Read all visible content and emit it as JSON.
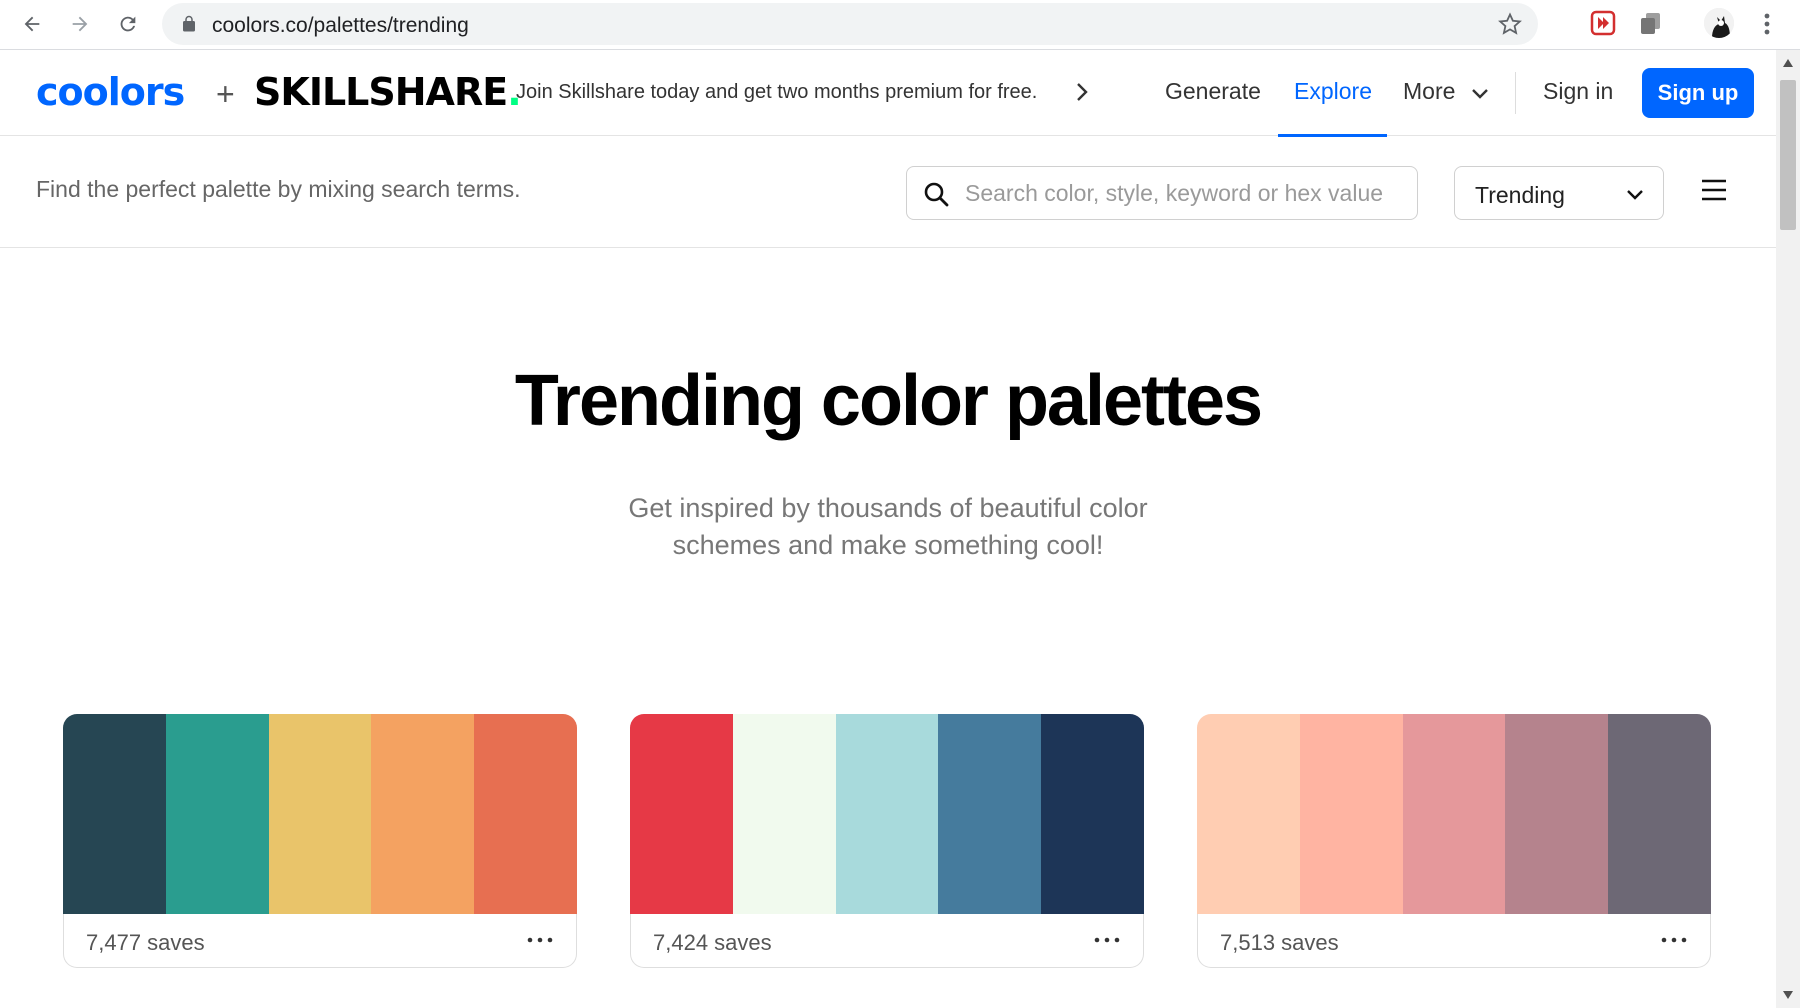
{
  "browser": {
    "url": "coolors.co/palettes/trending",
    "icons": [
      "back-icon",
      "forward-icon",
      "reload-icon",
      "lock-icon",
      "star-icon",
      "extension-icon",
      "profile-avatar",
      "menu-kebab-icon"
    ]
  },
  "header": {
    "logo_coolors": "coolors",
    "logo_plus": "+",
    "logo_skillshare": "SKILLSHARE",
    "logo_skillshare_dot": ".",
    "promo_text": "Join Skillshare today and get two months premium for free.",
    "nav": {
      "generate": "Generate",
      "explore": "Explore",
      "more": "More",
      "signin": "Sign in",
      "signup": "Sign up"
    },
    "active_nav": "Explore",
    "accent_color": "#0066ff",
    "skillshare_dot_color": "#00ff84"
  },
  "search": {
    "hint": "Find the perfect palette by mixing search terms.",
    "placeholder": "Search color, style, keyword or hex value",
    "value": "",
    "sort_selected": "Trending"
  },
  "hero": {
    "title": "Trending color palettes",
    "subtitle": "Get inspired by thousands of beautiful color schemes and make something cool!"
  },
  "palettes": [
    {
      "saves": "7,477 saves",
      "colors": [
        "#264653",
        "#2a9d8f",
        "#e9c46a",
        "#f4a261",
        "#e76f51"
      ]
    },
    {
      "saves": "7,424 saves",
      "colors": [
        "#e63946",
        "#f1faee",
        "#a8dadc",
        "#457b9d",
        "#1d3557"
      ]
    },
    {
      "saves": "7,513 saves",
      "colors": [
        "#ffcdb2",
        "#ffb4a2",
        "#e5989b",
        "#b5838d",
        "#6d6875"
      ]
    }
  ]
}
